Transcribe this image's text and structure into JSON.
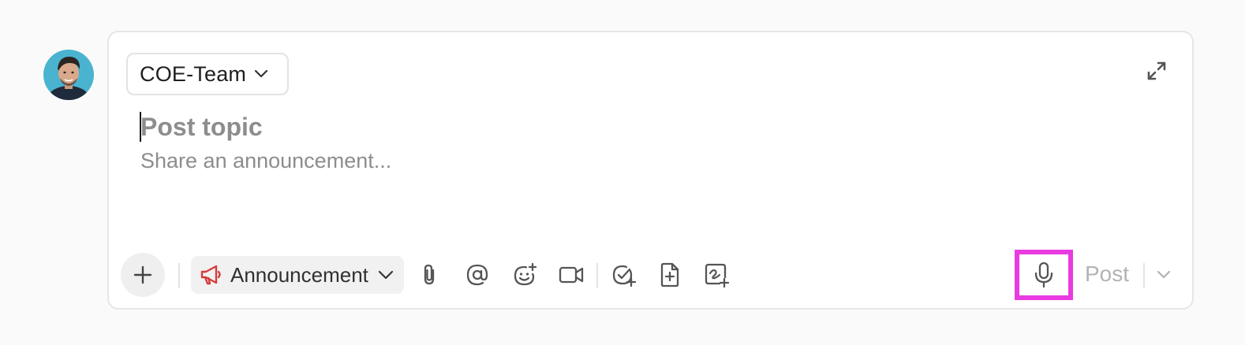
{
  "user": {
    "avatar_icon": "user-avatar-photo"
  },
  "composer": {
    "channel": {
      "label": "COE-Team",
      "icon": "chevron-down-icon"
    },
    "expand_icon": "expand-arrows-icon",
    "topic_placeholder": "Post topic",
    "body_placeholder": "Share an announcement..."
  },
  "toolbar": {
    "add_icon": "plus-icon",
    "post_type": {
      "label": "Announcement",
      "icon": "megaphone-icon",
      "icon_color": "#d63b3b"
    },
    "tools": [
      {
        "name": "attach-icon"
      },
      {
        "name": "mention-icon"
      },
      {
        "name": "emoji-icon"
      },
      {
        "name": "video-icon"
      },
      {
        "name": "task-icon"
      },
      {
        "name": "add-doc-icon"
      },
      {
        "name": "whiteboard-icon"
      }
    ],
    "mic_icon": "microphone-icon",
    "highlight_color": "#e83be0",
    "post_label": "Post",
    "post_more_icon": "chevron-down-icon"
  }
}
